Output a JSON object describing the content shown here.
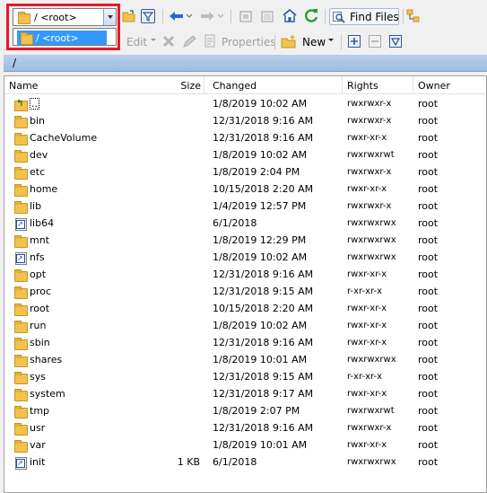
{
  "path_combo": {
    "value": "/ <root>"
  },
  "path_dropdown": {
    "option": "/ <root>"
  },
  "toolbar": {
    "find_files_label": "Find Files",
    "edit_label": "Edit",
    "properties_label": "Properties",
    "new_label": "New"
  },
  "address_bar": {
    "path": "/"
  },
  "colors": {
    "address_bar": "#a9c6ea",
    "selection": "#3399ff",
    "highlight_box": "#e8182a"
  },
  "columns": {
    "name": "Name",
    "size": "Size",
    "changed": "Changed",
    "rights": "Rights",
    "owner": "Owner"
  },
  "rows": [
    {
      "icon": "up",
      "name": "..",
      "size": "",
      "changed": "1/8/2019 10:02 AM",
      "rights": "rwxrwxr-x",
      "owner": "root"
    },
    {
      "icon": "folder",
      "name": "bin",
      "size": "",
      "changed": "12/31/2018 9:16 AM",
      "rights": "rwxrwxr-x",
      "owner": "root"
    },
    {
      "icon": "folder",
      "name": "CacheVolume",
      "size": "",
      "changed": "12/31/2018 9:16 AM",
      "rights": "rwxr-xr-x",
      "owner": "root"
    },
    {
      "icon": "folder",
      "name": "dev",
      "size": "",
      "changed": "1/8/2019 10:02 AM",
      "rights": "rwxrwxrwt",
      "owner": "root"
    },
    {
      "icon": "folder",
      "name": "etc",
      "size": "",
      "changed": "1/8/2019 2:04 PM",
      "rights": "rwxrwxr-x",
      "owner": "root"
    },
    {
      "icon": "folder",
      "name": "home",
      "size": "",
      "changed": "10/15/2018 2:20 AM",
      "rights": "rwxr-xr-x",
      "owner": "root"
    },
    {
      "icon": "folder",
      "name": "lib",
      "size": "",
      "changed": "1/4/2019 12:57 PM",
      "rights": "rwxrwxr-x",
      "owner": "root"
    },
    {
      "icon": "link",
      "name": "lib64",
      "size": "",
      "changed": "6/1/2018",
      "rights": "rwxrwxrwx",
      "owner": "root"
    },
    {
      "icon": "folder",
      "name": "mnt",
      "size": "",
      "changed": "1/8/2019 12:29 PM",
      "rights": "rwxrwxrwx",
      "owner": "root"
    },
    {
      "icon": "link",
      "name": "nfs",
      "size": "",
      "changed": "1/8/2019 10:02 AM",
      "rights": "rwxrwxrwx",
      "owner": "root"
    },
    {
      "icon": "folder",
      "name": "opt",
      "size": "",
      "changed": "12/31/2018 9:16 AM",
      "rights": "rwxr-xr-x",
      "owner": "root"
    },
    {
      "icon": "folder",
      "name": "proc",
      "size": "",
      "changed": "12/31/2018 9:15 AM",
      "rights": "r-xr-xr-x",
      "owner": "root"
    },
    {
      "icon": "folder",
      "name": "root",
      "size": "",
      "changed": "10/15/2018 2:20 AM",
      "rights": "rwxr-xr-x",
      "owner": "root"
    },
    {
      "icon": "folder",
      "name": "run",
      "size": "",
      "changed": "1/8/2019 10:02 AM",
      "rights": "rwxr-xr-x",
      "owner": "root"
    },
    {
      "icon": "folder",
      "name": "sbin",
      "size": "",
      "changed": "12/31/2018 9:16 AM",
      "rights": "rwxr-xr-x",
      "owner": "root"
    },
    {
      "icon": "folder",
      "name": "shares",
      "size": "",
      "changed": "1/8/2019 10:01 AM",
      "rights": "rwxrwxrwx",
      "owner": "root"
    },
    {
      "icon": "folder",
      "name": "sys",
      "size": "",
      "changed": "12/31/2018 9:15 AM",
      "rights": "r-xr-xr-x",
      "owner": "root"
    },
    {
      "icon": "folder",
      "name": "system",
      "size": "",
      "changed": "12/31/2018 9:17 AM",
      "rights": "rwxr-xr-x",
      "owner": "root"
    },
    {
      "icon": "folder",
      "name": "tmp",
      "size": "",
      "changed": "1/8/2019 2:07 PM",
      "rights": "rwxrwxrwt",
      "owner": "root"
    },
    {
      "icon": "folder",
      "name": "usr",
      "size": "",
      "changed": "12/31/2018 9:16 AM",
      "rights": "rwxrwxr-x",
      "owner": "root"
    },
    {
      "icon": "folder",
      "name": "var",
      "size": "",
      "changed": "1/8/2019 10:01 AM",
      "rights": "rwxr-xr-x",
      "owner": "root"
    },
    {
      "icon": "link",
      "name": "init",
      "size": "1 KB",
      "changed": "6/1/2018",
      "rights": "rwxrwxrwx",
      "owner": "root"
    }
  ]
}
